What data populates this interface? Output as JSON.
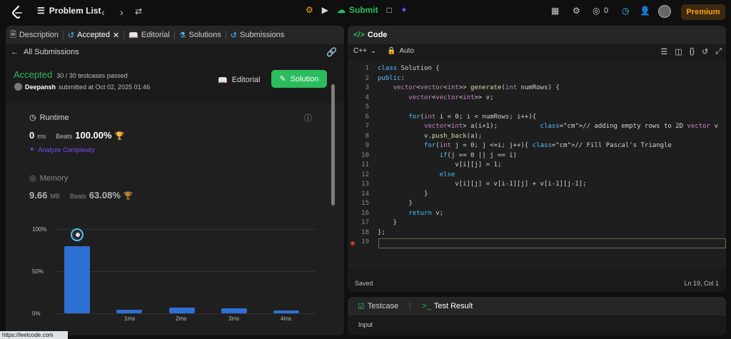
{
  "topbar": {
    "app_name": "Problem List",
    "submit_label": "Submit",
    "count": "0",
    "premium": "Premium"
  },
  "left_panel": {
    "tabs": [
      "Description",
      "Accepted",
      "Editorial",
      "Solutions",
      "Submissions"
    ],
    "all_submissions": "All Submissions",
    "status": "Accepted",
    "passed": "30 / 30 testcases passed",
    "user": "Deepansh",
    "submitted_at": "submitted at Oct 02, 2025 01:46",
    "editorial_button": "Editorial",
    "solution_button": "Solution",
    "runtime": {
      "title": "Runtime",
      "value": "0",
      "unit": "ms",
      "beats_label": "Beats",
      "beats": "100.00%",
      "analyze": "Analyze Complexity"
    },
    "memory": {
      "title": "Memory",
      "value": "9.66",
      "unit": "MB",
      "beats_label": "Beats",
      "beats": "63.08%"
    },
    "chart": {
      "y_labels": [
        "100%",
        "50%",
        "0%"
      ],
      "x_labels": [
        "1ms",
        "2ms",
        "3ms",
        "4ms"
      ]
    }
  },
  "chart_data": {
    "type": "bar",
    "categories": [
      "",
      "1ms",
      "2ms",
      "3ms",
      "4ms"
    ],
    "values": [
      80,
      4,
      7,
      6,
      3
    ],
    "ylim": [
      0,
      100
    ],
    "yticks": [
      "100%",
      "50%",
      "0%"
    ]
  },
  "code_panel": {
    "title": "Code",
    "language": "C++",
    "mode": "Auto",
    "saved": "Saved",
    "cursor": "Ln 19, Col 1",
    "lines": [
      "class Solution {",
      "public:",
      "    vector<vector<int>> generate(int numRows) {",
      "        vector<vector<int>> v;",
      "",
      "        for(int i = 0; i < numRows; i++){",
      "            vector<int> a(i+1);           // adding empty rows to 2D vector v",
      "            v.push_back(a);",
      "            for(int j = 0; j <=i; j++){ // Fill Pascal's Triangle",
      "                if(j == 0 || j == i)",
      "                    v[i][j] = 1;",
      "                else",
      "                    v[i][j] = v[i-1][j] + v[i-1][j-1];",
      "            }",
      "        }",
      "        return v;",
      "    }",
      "};",
      ""
    ]
  },
  "test_panel": {
    "testcase_tab": "Testcase",
    "result_tab": "Test Result",
    "input_label": "Input"
  },
  "status_bar": {
    "url": "https://leetcode.com"
  },
  "colors": {
    "accent": "#2cbb5d",
    "premium": "#ffa116",
    "bar": "#2e6fd2"
  }
}
